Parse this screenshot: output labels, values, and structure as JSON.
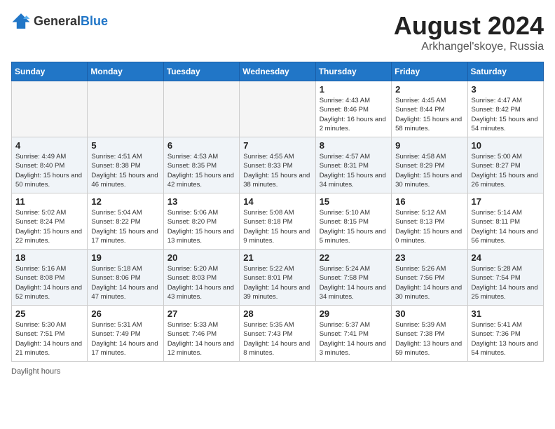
{
  "header": {
    "logo_general": "General",
    "logo_blue": "Blue",
    "title": "August 2024",
    "location": "Arkhangel'skoye, Russia"
  },
  "footer": {
    "daylight_label": "Daylight hours"
  },
  "weekdays": [
    "Sunday",
    "Monday",
    "Tuesday",
    "Wednesday",
    "Thursday",
    "Friday",
    "Saturday"
  ],
  "weeks": [
    [
      {
        "day": "",
        "info": ""
      },
      {
        "day": "",
        "info": ""
      },
      {
        "day": "",
        "info": ""
      },
      {
        "day": "",
        "info": ""
      },
      {
        "day": "1",
        "info": "Sunrise: 4:43 AM\nSunset: 8:46 PM\nDaylight: 16 hours\nand 2 minutes."
      },
      {
        "day": "2",
        "info": "Sunrise: 4:45 AM\nSunset: 8:44 PM\nDaylight: 15 hours\nand 58 minutes."
      },
      {
        "day": "3",
        "info": "Sunrise: 4:47 AM\nSunset: 8:42 PM\nDaylight: 15 hours\nand 54 minutes."
      }
    ],
    [
      {
        "day": "4",
        "info": "Sunrise: 4:49 AM\nSunset: 8:40 PM\nDaylight: 15 hours\nand 50 minutes."
      },
      {
        "day": "5",
        "info": "Sunrise: 4:51 AM\nSunset: 8:38 PM\nDaylight: 15 hours\nand 46 minutes."
      },
      {
        "day": "6",
        "info": "Sunrise: 4:53 AM\nSunset: 8:35 PM\nDaylight: 15 hours\nand 42 minutes."
      },
      {
        "day": "7",
        "info": "Sunrise: 4:55 AM\nSunset: 8:33 PM\nDaylight: 15 hours\nand 38 minutes."
      },
      {
        "day": "8",
        "info": "Sunrise: 4:57 AM\nSunset: 8:31 PM\nDaylight: 15 hours\nand 34 minutes."
      },
      {
        "day": "9",
        "info": "Sunrise: 4:58 AM\nSunset: 8:29 PM\nDaylight: 15 hours\nand 30 minutes."
      },
      {
        "day": "10",
        "info": "Sunrise: 5:00 AM\nSunset: 8:27 PM\nDaylight: 15 hours\nand 26 minutes."
      }
    ],
    [
      {
        "day": "11",
        "info": "Sunrise: 5:02 AM\nSunset: 8:24 PM\nDaylight: 15 hours\nand 22 minutes."
      },
      {
        "day": "12",
        "info": "Sunrise: 5:04 AM\nSunset: 8:22 PM\nDaylight: 15 hours\nand 17 minutes."
      },
      {
        "day": "13",
        "info": "Sunrise: 5:06 AM\nSunset: 8:20 PM\nDaylight: 15 hours\nand 13 minutes."
      },
      {
        "day": "14",
        "info": "Sunrise: 5:08 AM\nSunset: 8:18 PM\nDaylight: 15 hours\nand 9 minutes."
      },
      {
        "day": "15",
        "info": "Sunrise: 5:10 AM\nSunset: 8:15 PM\nDaylight: 15 hours\nand 5 minutes."
      },
      {
        "day": "16",
        "info": "Sunrise: 5:12 AM\nSunset: 8:13 PM\nDaylight: 15 hours\nand 0 minutes."
      },
      {
        "day": "17",
        "info": "Sunrise: 5:14 AM\nSunset: 8:11 PM\nDaylight: 14 hours\nand 56 minutes."
      }
    ],
    [
      {
        "day": "18",
        "info": "Sunrise: 5:16 AM\nSunset: 8:08 PM\nDaylight: 14 hours\nand 52 minutes."
      },
      {
        "day": "19",
        "info": "Sunrise: 5:18 AM\nSunset: 8:06 PM\nDaylight: 14 hours\nand 47 minutes."
      },
      {
        "day": "20",
        "info": "Sunrise: 5:20 AM\nSunset: 8:03 PM\nDaylight: 14 hours\nand 43 minutes."
      },
      {
        "day": "21",
        "info": "Sunrise: 5:22 AM\nSunset: 8:01 PM\nDaylight: 14 hours\nand 39 minutes."
      },
      {
        "day": "22",
        "info": "Sunrise: 5:24 AM\nSunset: 7:58 PM\nDaylight: 14 hours\nand 34 minutes."
      },
      {
        "day": "23",
        "info": "Sunrise: 5:26 AM\nSunset: 7:56 PM\nDaylight: 14 hours\nand 30 minutes."
      },
      {
        "day": "24",
        "info": "Sunrise: 5:28 AM\nSunset: 7:54 PM\nDaylight: 14 hours\nand 25 minutes."
      }
    ],
    [
      {
        "day": "25",
        "info": "Sunrise: 5:30 AM\nSunset: 7:51 PM\nDaylight: 14 hours\nand 21 minutes."
      },
      {
        "day": "26",
        "info": "Sunrise: 5:31 AM\nSunset: 7:49 PM\nDaylight: 14 hours\nand 17 minutes."
      },
      {
        "day": "27",
        "info": "Sunrise: 5:33 AM\nSunset: 7:46 PM\nDaylight: 14 hours\nand 12 minutes."
      },
      {
        "day": "28",
        "info": "Sunrise: 5:35 AM\nSunset: 7:43 PM\nDaylight: 14 hours\nand 8 minutes."
      },
      {
        "day": "29",
        "info": "Sunrise: 5:37 AM\nSunset: 7:41 PM\nDaylight: 14 hours\nand 3 minutes."
      },
      {
        "day": "30",
        "info": "Sunrise: 5:39 AM\nSunset: 7:38 PM\nDaylight: 13 hours\nand 59 minutes."
      },
      {
        "day": "31",
        "info": "Sunrise: 5:41 AM\nSunset: 7:36 PM\nDaylight: 13 hours\nand 54 minutes."
      }
    ]
  ]
}
